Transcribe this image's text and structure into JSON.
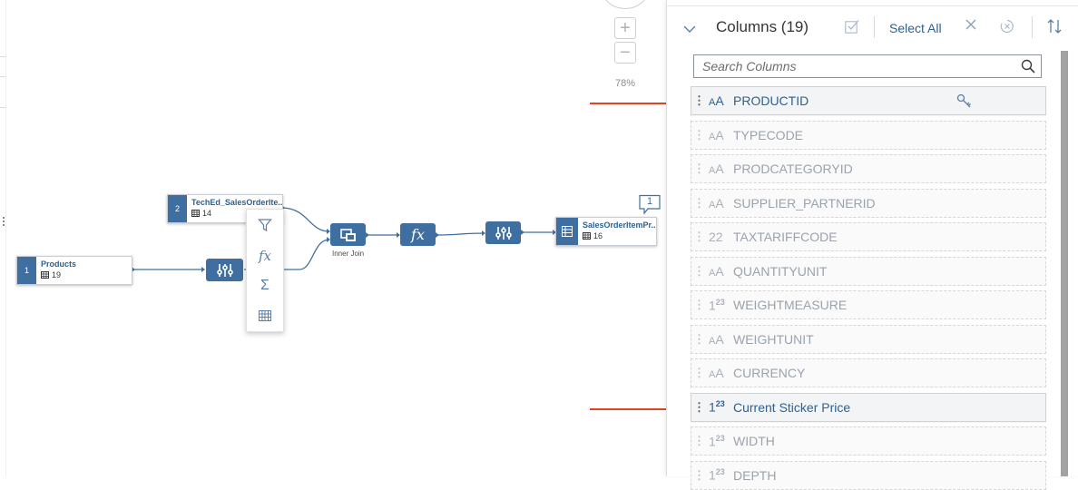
{
  "canvas": {
    "zoom_level": "78%",
    "zoom_in_symbol": "+",
    "zoom_out_symbol": "−",
    "nodes": {
      "products": {
        "number": "1",
        "title": "Products",
        "column_count": "19"
      },
      "sales_order": {
        "number": "2",
        "title": "TechEd_SalesOrderIte...",
        "column_count": "14"
      },
      "output": {
        "title": "SalesOrderItemPr...",
        "column_count": "16"
      }
    },
    "join_label": "Inner Join",
    "comment_count": "1",
    "context_menu": {
      "items": [
        {
          "icon": "filter-icon"
        },
        {
          "icon": "calculated-column-icon",
          "label": "fx"
        },
        {
          "icon": "aggregation-icon",
          "label": "Σ"
        },
        {
          "icon": "table-icon"
        }
      ]
    }
  },
  "columns_panel": {
    "title": "Columns (19)",
    "select_all_label": "Select All",
    "search": {
      "placeholder": "Search Columns",
      "value": ""
    },
    "columns": [
      {
        "type_label": "AA",
        "name": "PRODUCTID",
        "key": true,
        "active": true
      },
      {
        "type_label": "AA",
        "name": "TYPECODE",
        "key": false,
        "active": false
      },
      {
        "type_label": "AA",
        "name": "PRODCATEGORYID",
        "key": false,
        "active": false
      },
      {
        "type_label": "AA",
        "name": "SUPPLIER_PARTNERID",
        "key": false,
        "active": false
      },
      {
        "type_label": "22",
        "name": "TAXTARIFFCODE",
        "key": false,
        "active": false
      },
      {
        "type_label": "AA",
        "name": "QUANTITYUNIT",
        "key": false,
        "active": false
      },
      {
        "type_label": "123",
        "name": "WEIGHTMEASURE",
        "key": false,
        "active": false
      },
      {
        "type_label": "AA",
        "name": "WEIGHTUNIT",
        "key": false,
        "active": false
      },
      {
        "type_label": "AA",
        "name": "CURRENCY",
        "key": false,
        "active": false
      },
      {
        "type_label": "123",
        "name": "Current Sticker Price",
        "key": false,
        "active": true
      },
      {
        "type_label": "123",
        "name": "WIDTH",
        "key": false,
        "active": false
      },
      {
        "type_label": "123",
        "name": "DEPTH",
        "key": false,
        "active": false
      }
    ]
  },
  "colors": {
    "accent": "#2b6195",
    "node_fill": "#3f6fa0",
    "annotation_arrow": "#e8421d"
  }
}
